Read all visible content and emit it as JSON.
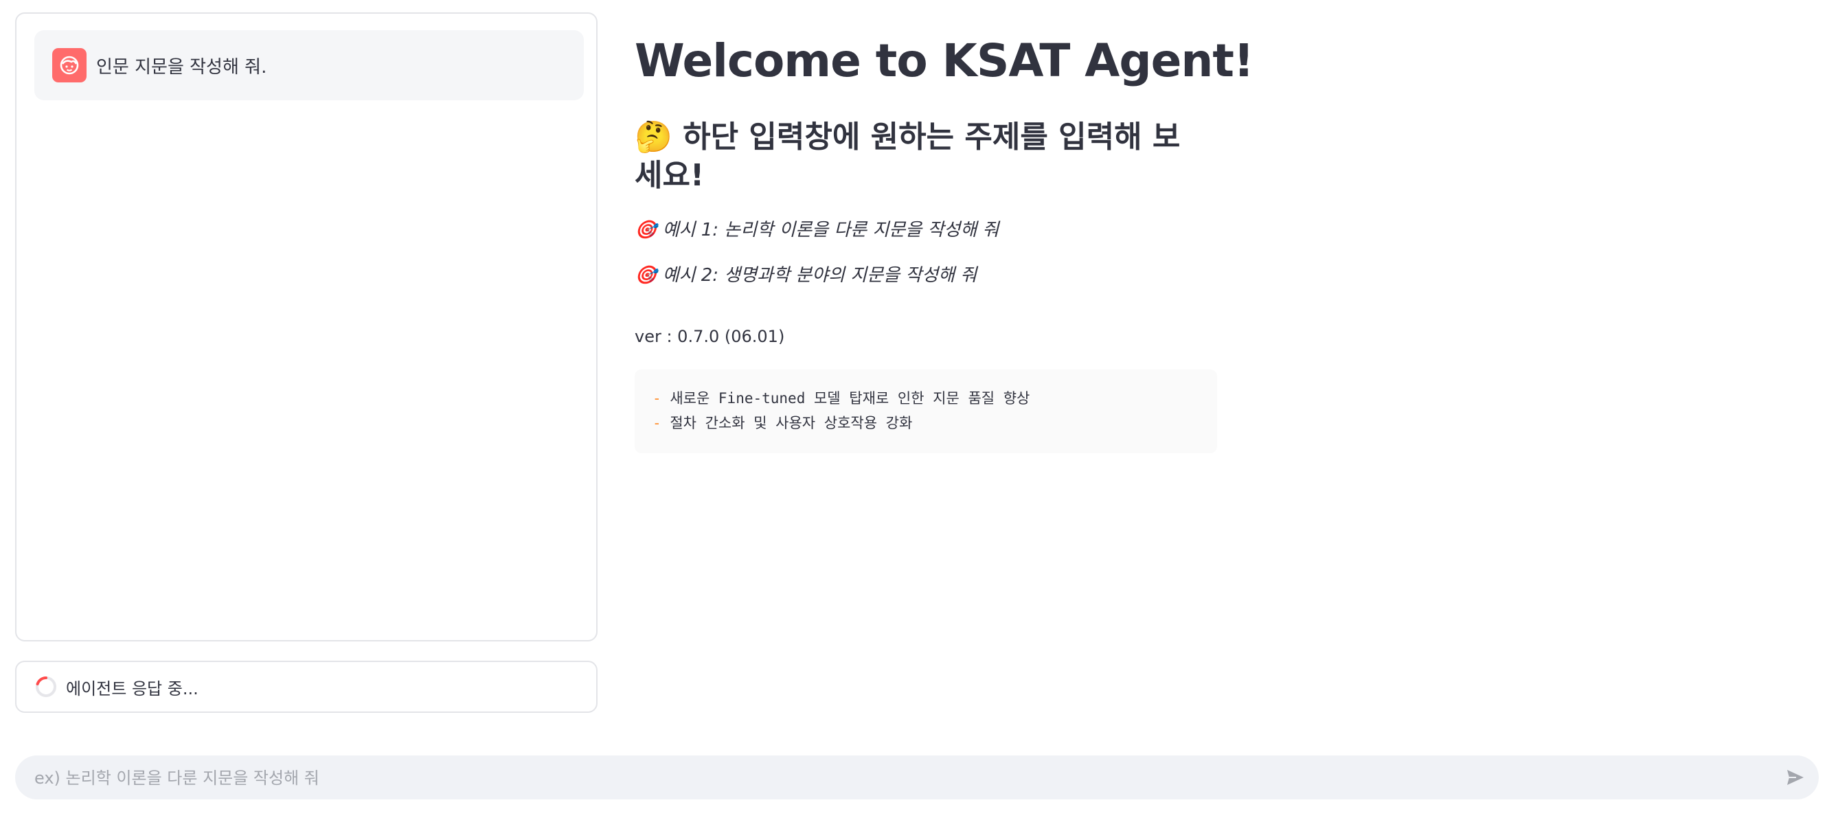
{
  "chat": {
    "messages": [
      {
        "role": "user",
        "text": "인문 지문을 작성해 줘.",
        "avatar_icon": "user-face-icon",
        "avatar_color": "#ff6b6b"
      }
    ],
    "status": {
      "text": "에이전트 응답 중...",
      "icon": "spinner-icon"
    }
  },
  "main": {
    "title": "Welcome to KSAT Agent!",
    "subtitle_emoji": "🤔",
    "subtitle": "하단 입력창에 원하는 주제를 입력해 보세요!",
    "examples": [
      {
        "emoji": "🎯",
        "text": "예시 1: 논리학 이론을 다룬 지문을 작성해 줘"
      },
      {
        "emoji": "🎯",
        "text": "예시 2: 생명과학 분야의 지문을 작성해 줘"
      }
    ],
    "version": "ver : 0.7.0 (06.01)",
    "changelog": [
      {
        "marker": "-",
        "text": "새로운 Fine-tuned 모델 탑재로 인한 지문 품질 향상"
      },
      {
        "marker": "-",
        "text": "절차 간소화 및 사용자 상호작용 강화"
      }
    ]
  },
  "input": {
    "placeholder": "ex) 논리학 이론을 다룬 지문을 작성해 줘",
    "value": "",
    "send_icon": "send-icon"
  },
  "colors": {
    "accent": "#ff4b4b",
    "avatar": "#ff6b6b",
    "dash": "#ff8c28",
    "text": "#31333f",
    "placeholder": "#a3a6ad"
  }
}
